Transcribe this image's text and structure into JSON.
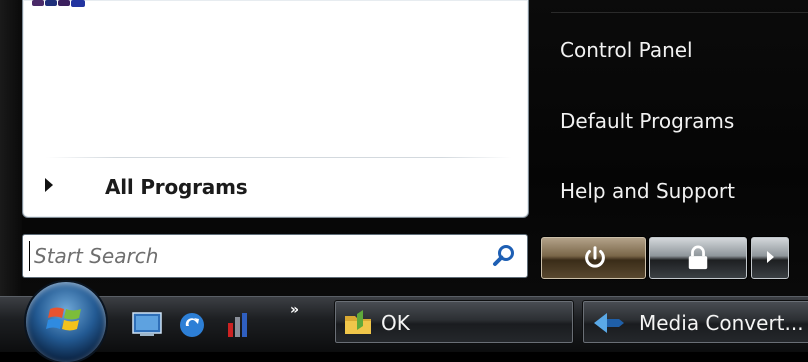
{
  "left_pane": {
    "all_programs_label": "All Programs"
  },
  "search": {
    "placeholder": "Start Search",
    "value": ""
  },
  "right_links": [
    {
      "label": "Control Panel"
    },
    {
      "label": "Default Programs"
    },
    {
      "label": "Help and Support"
    }
  ],
  "power_controls": {
    "power_icon": "power-icon",
    "lock_icon": "lock-icon",
    "arrow_icon": "arrow-right-icon"
  },
  "taskbar": {
    "quicklaunch_overflow": "»",
    "tasks": [
      {
        "label": "OK"
      },
      {
        "label": "Media Convert..."
      }
    ]
  },
  "colors": {
    "menu_bg": "#050505",
    "right_text": "#f2f2f2",
    "power_btn": "#7a6749"
  }
}
